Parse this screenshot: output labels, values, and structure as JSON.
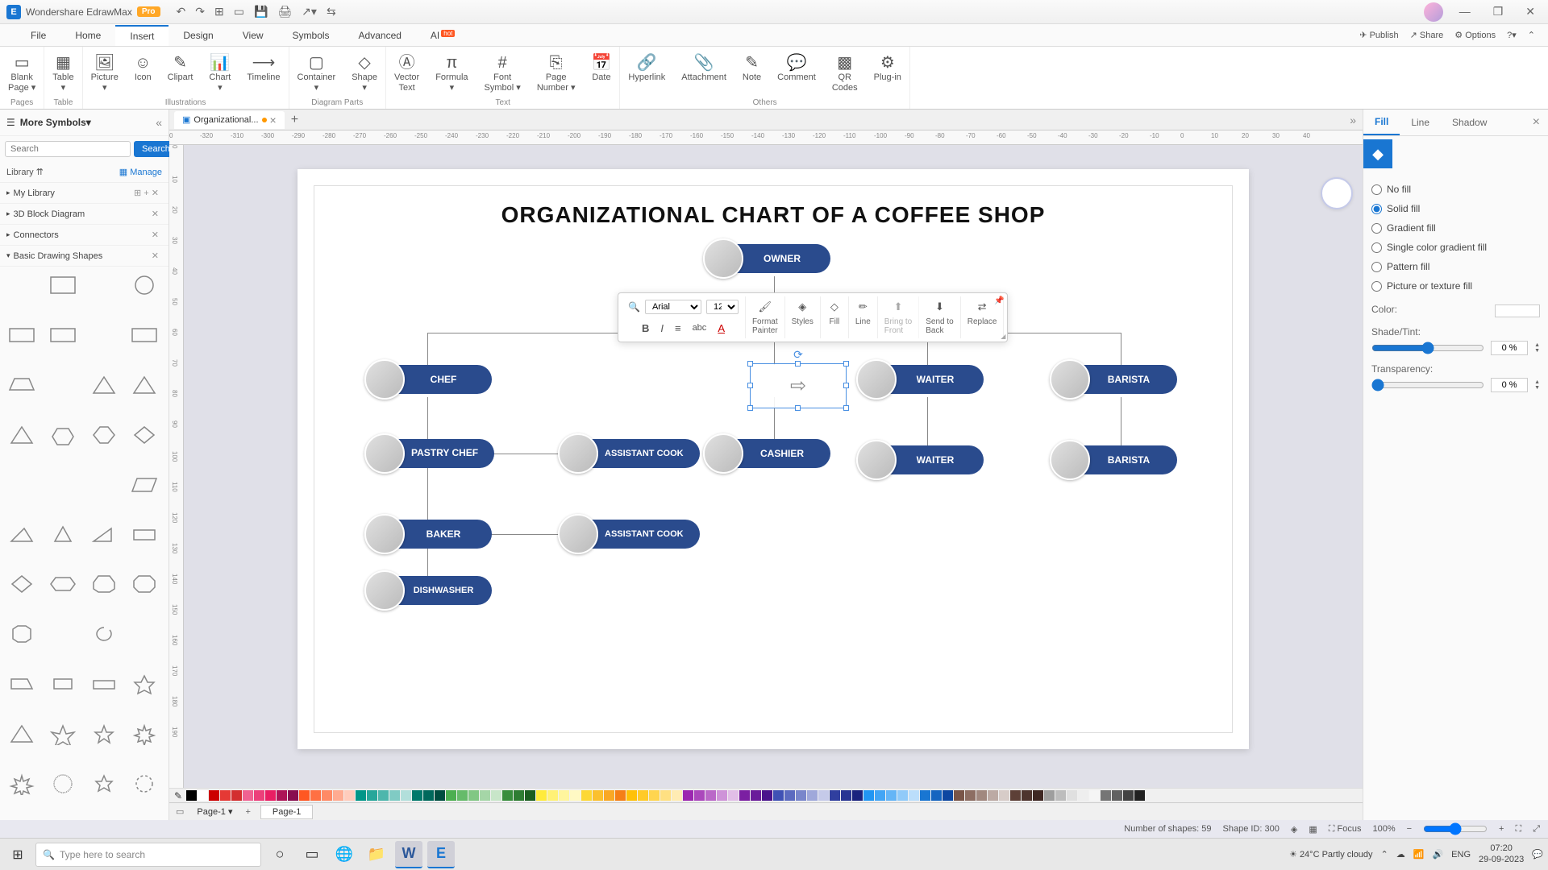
{
  "app": {
    "name": "Wondershare EdrawMax",
    "pro": "Pro"
  },
  "qat": {
    "undo": "↶",
    "redo": "↷",
    "new": "⊞",
    "open": "▭",
    "save": "💾",
    "print": "🖨",
    "export": "↗▾",
    "more": "⇆"
  },
  "win": {
    "min": "—",
    "max": "❐",
    "close": "✕"
  },
  "menu": {
    "items": [
      "File",
      "Home",
      "Insert",
      "Design",
      "View",
      "Symbols",
      "Advanced"
    ],
    "ai": "AI",
    "hot": "hot",
    "active": "Insert",
    "right": {
      "publish": "Publish",
      "share": "Share",
      "options": "Options",
      "help": "?"
    }
  },
  "ribbon": {
    "groups": [
      {
        "label": "Pages",
        "items": [
          {
            "icon": "▭",
            "text": "Blank\nPage ▾"
          }
        ]
      },
      {
        "label": "Table",
        "items": [
          {
            "icon": "▦",
            "text": "Table\n▾"
          }
        ]
      },
      {
        "label": "Illustrations",
        "items": [
          {
            "icon": "🖼",
            "text": "Picture\n▾"
          },
          {
            "icon": "☺",
            "text": "Icon"
          },
          {
            "icon": "✎",
            "text": "Clipart"
          },
          {
            "icon": "📊",
            "text": "Chart\n▾"
          },
          {
            "icon": "⟶",
            "text": "Timeline"
          }
        ]
      },
      {
        "label": "Diagram Parts",
        "items": [
          {
            "icon": "▢",
            "text": "Container\n▾"
          },
          {
            "icon": "◇",
            "text": "Shape\n▾"
          }
        ]
      },
      {
        "label": "Text",
        "items": [
          {
            "icon": "Ⓐ",
            "text": "Vector\nText"
          },
          {
            "icon": "π",
            "text": "Formula\n▾"
          },
          {
            "icon": "#",
            "text": "Font\nSymbol ▾"
          },
          {
            "icon": "⎘",
            "text": "Page\nNumber ▾"
          },
          {
            "icon": "📅",
            "text": "Date"
          }
        ]
      },
      {
        "label": "Others",
        "items": [
          {
            "icon": "🔗",
            "text": "Hyperlink"
          },
          {
            "icon": "📎",
            "text": "Attachment"
          },
          {
            "icon": "✎",
            "text": "Note"
          },
          {
            "icon": "💬",
            "text": "Comment"
          },
          {
            "icon": "▩",
            "text": "QR\nCodes"
          },
          {
            "icon": "⚙",
            "text": "Plug-in"
          }
        ]
      }
    ]
  },
  "left": {
    "header": "More Symbols",
    "search_ph": "Search",
    "search_btn": "Search",
    "library": "Library",
    "manage": "Manage",
    "cats": [
      {
        "t": "My Library",
        "icons": "⊞ + ✕"
      },
      {
        "t": "3D Block Diagram",
        "icons": "✕"
      },
      {
        "t": "Connectors",
        "icons": "✕"
      },
      {
        "t": "Basic Drawing Shapes",
        "icons": "✕",
        "open": true
      }
    ]
  },
  "doc": {
    "tab": "Organizational...",
    "page": "Page-1"
  },
  "ruler_h": [
    0,
    -320,
    -310,
    -300,
    -290,
    -280,
    -270,
    -260,
    -250,
    -240,
    -230,
    -220,
    -210,
    -200,
    -190,
    -180,
    -170,
    -160,
    -150,
    -140,
    -130,
    -120,
    -110,
    -100,
    -90,
    -80,
    -70,
    -60,
    -50,
    -40,
    -30,
    -20,
    -10,
    0,
    10,
    20,
    30,
    40
  ],
  "ruler_v": [
    0,
    10,
    20,
    30,
    40,
    50,
    60,
    70,
    80,
    90,
    100,
    110,
    120,
    130,
    140,
    150,
    160,
    170,
    180,
    190
  ],
  "chart": {
    "title": "ORGANIZATIONAL CHART OF A COFFEE SHOP",
    "nodes": {
      "owner": "OWNER",
      "chef": "CHEF",
      "cashier": "CASHIER",
      "waiter1": "WAITER",
      "barista1": "BARISTA",
      "pastry": "PASTRY CHEF",
      "asst1": "ASSISTANT COOK",
      "waiter2": "WAITER",
      "barista2": "BARISTA",
      "baker": "BAKER",
      "asst2": "ASSISTANT COOK",
      "dish": "DISHWASHER"
    }
  },
  "float": {
    "font": "Arial",
    "size": "12",
    "items": {
      "format": "Format\nPainter",
      "styles": "Styles",
      "fill": "Fill",
      "line": "Line",
      "front": "Bring to\nFront",
      "back": "Send to\nBack",
      "replace": "Replace"
    }
  },
  "right": {
    "tabs": [
      "Fill",
      "Line",
      "Shadow"
    ],
    "active": "Fill",
    "opts": [
      "No fill",
      "Solid fill",
      "Gradient fill",
      "Single color gradient fill",
      "Pattern fill",
      "Picture or texture fill"
    ],
    "sel": "Solid fill",
    "color_lbl": "Color:",
    "shade_lbl": "Shade/Tint:",
    "trans_lbl": "Transparency:",
    "shade_val": "0 %",
    "trans_val": "0 %"
  },
  "status": {
    "shapes_lbl": "Number of shapes:",
    "shapes": "59",
    "shapeid_lbl": "Shape ID:",
    "shapeid": "300",
    "focus": "Focus",
    "zoom": "100%"
  },
  "taskbar": {
    "search": "Type here to search",
    "weather": "24°C  Partly cloudy",
    "time": "07:20",
    "date": "29-09-2023"
  }
}
